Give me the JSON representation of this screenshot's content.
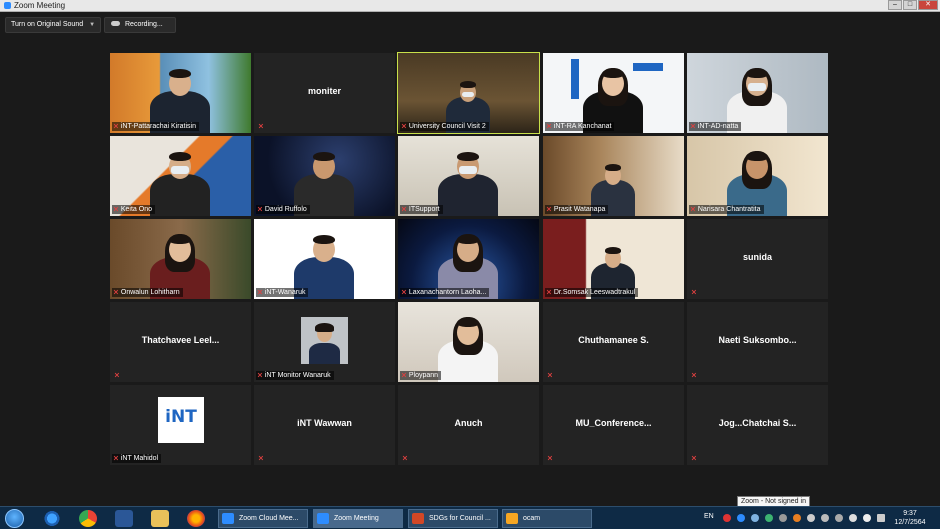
{
  "window": {
    "title": "Zoom Meeting"
  },
  "controls": {
    "audio_label": "Turn on Original Sound",
    "recording_label": "Recording..."
  },
  "participants": [
    {
      "name": "iNT-Pattarachai Kiratisin",
      "video": true
    },
    {
      "name": "moniter",
      "video": false
    },
    {
      "name": "University Council Visit 2",
      "video": true,
      "active_speaker": true
    },
    {
      "name": "iNT-RA Kanchanat",
      "video": true
    },
    {
      "name": "iNT-AD-natta",
      "video": true
    },
    {
      "name": "Keita Ono",
      "video": true
    },
    {
      "name": "David Ruffolo",
      "video": true
    },
    {
      "name": "ITSupport",
      "video": true
    },
    {
      "name": "Prasit Watanapa",
      "video": true
    },
    {
      "name": "Narisara Chantratita",
      "video": true
    },
    {
      "name": "Onwalun Lohitharn",
      "video": true
    },
    {
      "name": "iNT-Wanaruk",
      "video": true
    },
    {
      "name": "Laxanachantorn Laoha...",
      "video": true
    },
    {
      "name": "Dr.Somsak Leeswadtrakul",
      "video": true
    },
    {
      "name": "sunida",
      "video": false
    },
    {
      "name": "Thatchavee Leel...",
      "video": false
    },
    {
      "name": "iNT Monitor Wanaruk",
      "video": false,
      "avatar": true
    },
    {
      "name": "Ploypann",
      "video": true
    },
    {
      "name": "Chuthamanee S.",
      "video": false
    },
    {
      "name": "Naeti Suksombo...",
      "video": false
    },
    {
      "name": "iNT Mahidol",
      "video": false,
      "logo": true
    },
    {
      "name": "iNT Wawwan",
      "video": false
    },
    {
      "name": "Anuch",
      "video": false
    },
    {
      "name": "MU_Conference...",
      "video": false
    },
    {
      "name": "Jog...Chatchai S...",
      "video": false
    }
  ],
  "taskbar": {
    "apps": [
      {
        "label": "Zoom Cloud Mee...",
        "icon": "zoom-icon"
      },
      {
        "label": "Zoom Meeting",
        "icon": "zoom-icon",
        "active": true
      },
      {
        "label": "SDGs for Council ...",
        "icon": "powerpoint-icon"
      },
      {
        "label": "ocam",
        "icon": "ocam-icon"
      }
    ],
    "language": "EN",
    "time": "9:37",
    "date": "12/7/2564",
    "tooltip": "Zoom - Not signed in"
  },
  "logo_text": "iNT"
}
